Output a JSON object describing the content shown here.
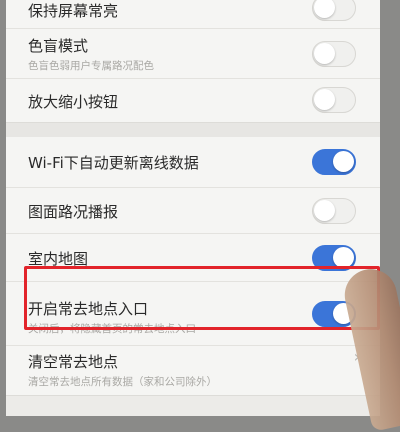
{
  "settings": {
    "keep_screen_on": {
      "title": "保持屏幕常亮",
      "enabled": false
    },
    "color_blind": {
      "title": "色盲模式",
      "subtitle": "色盲色弱用户专属路况配色",
      "enabled": false
    },
    "zoom_buttons": {
      "title": "放大缩小按钮",
      "enabled": false
    },
    "wifi_offline": {
      "title": "Wi-Fi下自动更新离线数据",
      "enabled": true
    },
    "traffic_broadcast": {
      "title": "图面路况播报",
      "enabled": false
    },
    "indoor_map": {
      "title": "室内地图",
      "enabled": true
    },
    "frequent_places": {
      "title": "开启常去地点入口",
      "subtitle": "关闭后，将隐藏首页的常去地点入口",
      "enabled": true
    },
    "clear_frequent": {
      "title": "清空常去地点",
      "subtitle": "清空常去地点所有数据（家和公司除外）"
    }
  },
  "colors": {
    "toggle_on": "#3b75d8",
    "highlight": "#e2242a"
  }
}
